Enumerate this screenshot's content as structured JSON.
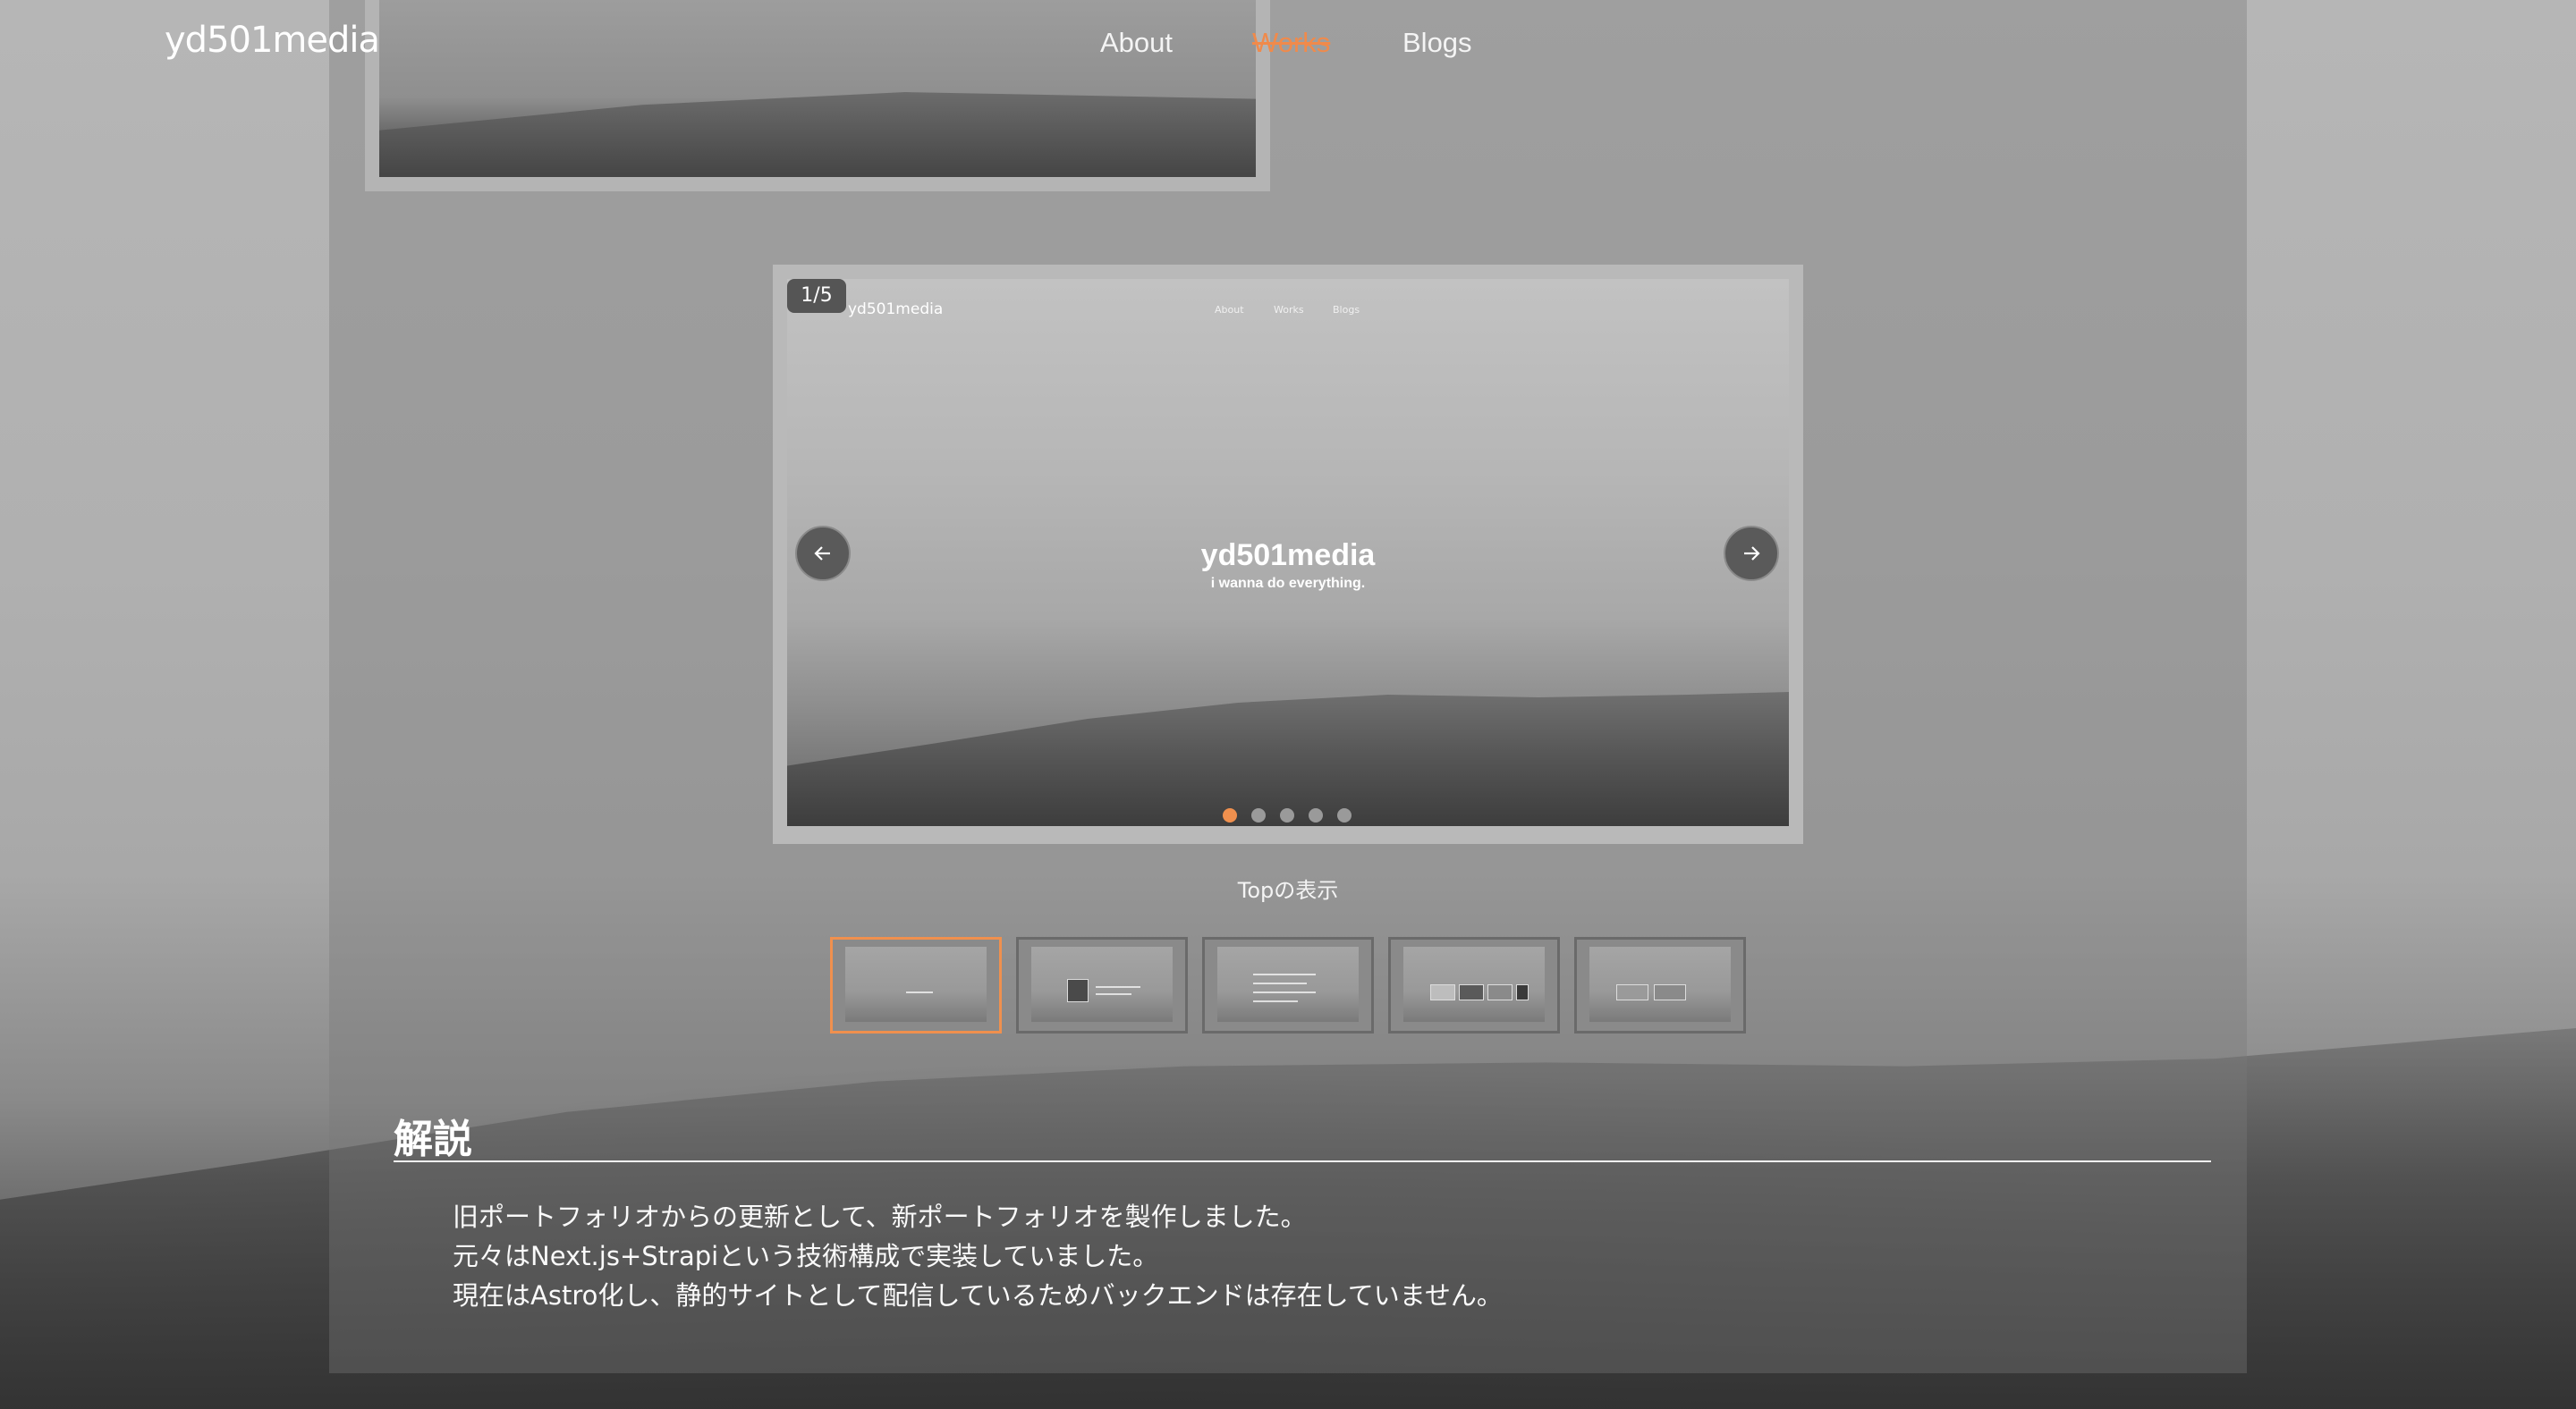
{
  "header": {
    "logo": "yd501media",
    "nav": [
      {
        "label": "About"
      },
      {
        "label": "Works",
        "active": true
      },
      {
        "label": "Blogs"
      }
    ]
  },
  "slider": {
    "counter": "1/5",
    "current_index": 1,
    "total": 5,
    "caption": "Topの表示",
    "slide_preview": {
      "logo": "yd501media",
      "nav": [
        "About",
        "Works",
        "Blogs"
      ],
      "title": "yd501media",
      "subtitle": "i wanna do everything."
    },
    "prev_button_icon": "arrow-left-icon",
    "next_button_icon": "arrow-right-icon"
  },
  "description": {
    "heading": "解説",
    "lines": [
      "旧ポートフォリオからの更新として、新ポートフォリオを製作しました。",
      "元々はNext.js+Strapiという技術構成で実装していました。",
      "現在はAstro化し、静的サイトとして配信しているためバックエンドは存在していません。"
    ]
  },
  "colors": {
    "accent": "#f0904e",
    "text": "#ffffff"
  }
}
